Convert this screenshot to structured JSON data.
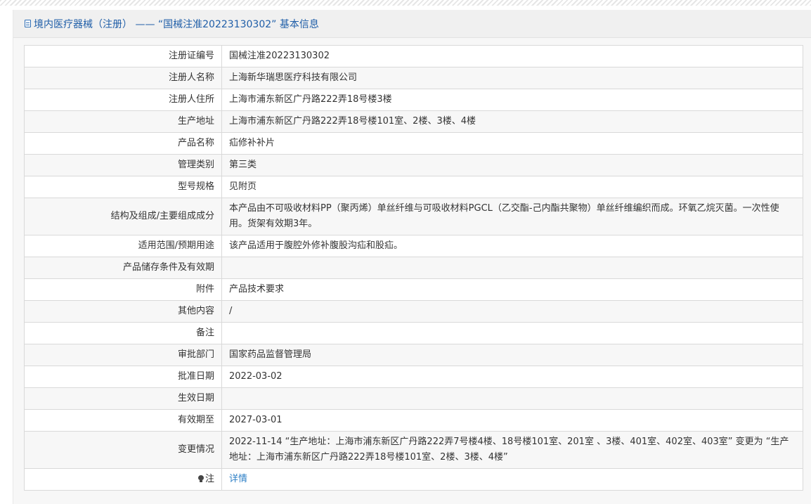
{
  "header": {
    "title": "境内医疗器械（注册） —— “国械注准20223130302” 基本信息"
  },
  "rows": [
    {
      "label": "注册证编号",
      "value": "国械注准20223130302"
    },
    {
      "label": "注册人名称",
      "value": "上海新华瑞思医疗科技有限公司"
    },
    {
      "label": "注册人住所",
      "value": "上海市浦东新区广丹路222弄18号楼3楼"
    },
    {
      "label": "生产地址",
      "value": "上海市浦东新区广丹路222弄18号楼101室、2楼、3楼、4楼"
    },
    {
      "label": "产品名称",
      "value": "疝修补补片"
    },
    {
      "label": "管理类别",
      "value": "第三类"
    },
    {
      "label": "型号规格",
      "value": "见附页"
    },
    {
      "label": "结构及组成/主要组成成分",
      "value": "本产品由不可吸收材料PP（聚丙烯）单丝纤维与可吸收材料PGCL（乙交酯-己内酯共聚物）单丝纤维编织而成。环氧乙烷灭菌。一次性使用。货架有效期3年。"
    },
    {
      "label": "适用范围/预期用途",
      "value": "该产品适用于腹腔外修补腹股沟疝和股疝。"
    },
    {
      "label": "产品储存条件及有效期",
      "value": ""
    },
    {
      "label": "附件",
      "value": "产品技术要求"
    },
    {
      "label": "其他内容",
      "value": "/"
    },
    {
      "label": "备注",
      "value": ""
    },
    {
      "label": "审批部门",
      "value": "国家药品监督管理局"
    },
    {
      "label": "批准日期",
      "value": "2022-03-02"
    },
    {
      "label": "生效日期",
      "value": ""
    },
    {
      "label": "有效期至",
      "value": "2027-03-01"
    },
    {
      "label": "变更情况",
      "value": "2022-11-14 “生产地址：上海市浦东新区广丹路222弄7号楼4楼、18号楼101室、201室 、3楼、401室、402室、403室” 变更为 “生产地址：上海市浦东新区广丹路222弄18号楼101室、2楼、3楼、4楼”"
    }
  ],
  "note_row": {
    "label": "注",
    "link_text": "详情",
    "icon": "lightbulb-icon"
  },
  "colors": {
    "title": "#1f5ea8",
    "link": "#2d7fc6",
    "border": "#d9d9d9",
    "stripe": "#f7f7f7"
  }
}
